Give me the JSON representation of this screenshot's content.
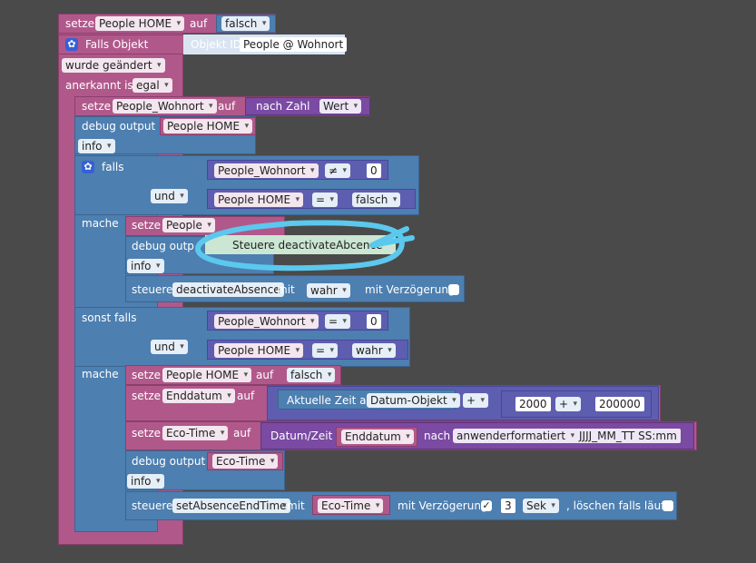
{
  "rows": {
    "r1": {
      "kw": "setze",
      "var": "People HOME",
      "auf": "auf",
      "val": "falsch"
    },
    "r2": {
      "label": "Falls Objekt",
      "objid_label": "Objekt ID",
      "objid": "People @ Wohnort"
    },
    "r3": {
      "val": "wurde geändert"
    },
    "r4": {
      "label": "anerkannt ist",
      "val": "egal"
    },
    "r5": {
      "kw": "setze",
      "var": "People_Wohnort",
      "auf": "auf",
      "fn": "nach Zahl",
      "arg": "Wert"
    },
    "r6": {
      "label": "debug output",
      "val": "People HOME",
      "level": "info"
    },
    "r7": {
      "label": "falls",
      "a": "People_Wohnort",
      "op": "≠",
      "b": "0"
    },
    "r8": {
      "und": "und",
      "a": "People HOME",
      "op": "=",
      "b": "falsch"
    },
    "r9": {
      "mache": "mache",
      "kw": "setze",
      "var": "People"
    },
    "r10": {
      "label": "debug outp",
      "text": "Steuere deactivateAbcence",
      "level": "info"
    },
    "r11": {
      "label": "steuere",
      "target": "deactivateAbsence",
      "mit": "mit",
      "val": "wahr",
      "delay": "mit Verzögerung"
    },
    "r12": {
      "label": "sonst falls",
      "a": "People_Wohnort",
      "op": "=",
      "b": "0"
    },
    "r13": {
      "und": "und",
      "a": "People HOME",
      "op": "=",
      "b": "wahr"
    },
    "r14": {
      "mache": "mache",
      "kw": "setze",
      "var": "People HOME",
      "auf": "auf",
      "val": "falsch"
    },
    "r15": {
      "kw": "setze",
      "var": "Enddatum",
      "auf": "auf",
      "label": "Aktuelle Zeit als",
      "fmt": "Datum-Objekt",
      "op1": "+",
      "n1": "2000",
      "op2": "+",
      "n2": "200000"
    },
    "r16": {
      "kw": "setze",
      "var": "Eco-Time",
      "auf": "auf",
      "label": "Datum/Zeit",
      "src": "Enddatum",
      "nach": "nach",
      "fmt": "anwenderformatiert",
      "pattern": "JJJJ_MM_TT SS:mm"
    },
    "r17": {
      "label": "debug output",
      "val": "Eco-Time",
      "level": "info"
    },
    "r18": {
      "label": "steuere",
      "target": "setAbsenceEndTime",
      "mit": "mit",
      "val": "Eco-Time",
      "delay": "mit Verzögerung",
      "check": "✓",
      "num": "3",
      "unit": "Sek",
      "clear": ", löschen falls läuft"
    }
  },
  "colors": {
    "setze": "#b1588b",
    "logic": "#4d7fb0",
    "func": "#7b4aa3",
    "math": "#5e5eb0",
    "annotation": "#5bc8ee"
  }
}
